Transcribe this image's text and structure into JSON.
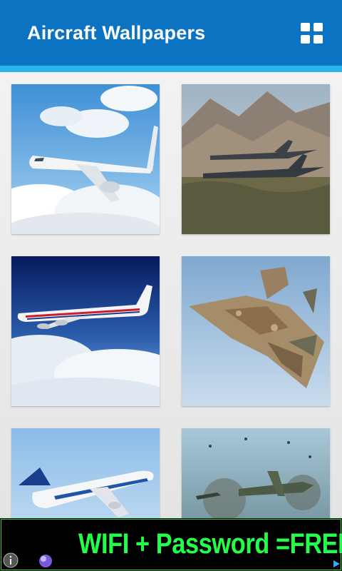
{
  "app": {
    "title": "Aircraft Wallpapers",
    "menu_icon": "grid-icon",
    "colors": {
      "appbar": "#0b73c1",
      "accent": "#29b4f0",
      "background": "#e6e6e6"
    }
  },
  "gallery": {
    "items": [
      {
        "subject": "passenger jet in clouds"
      },
      {
        "subject": "fighter jets over mountains"
      },
      {
        "subject": "jumbo jet above clouds"
      },
      {
        "subject": "camouflage stealth fighter"
      },
      {
        "subject": "airbus a380 takeoff"
      },
      {
        "subject": "warplanes battle"
      }
    ]
  },
  "ad": {
    "text": "WIFI  + Password =FREE",
    "text_color": "#22ff4a",
    "icons": [
      "info-icon",
      "orb-icon",
      "play-icon"
    ]
  }
}
